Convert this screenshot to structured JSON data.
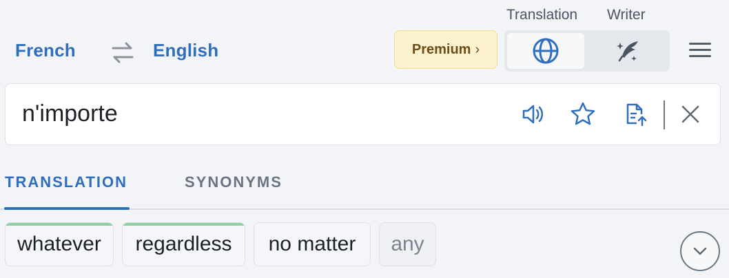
{
  "languages": {
    "source": "French",
    "target": "English",
    "swap_icon": "swap-arrows-icon"
  },
  "premium": {
    "label": "Premium",
    "chevron": "›"
  },
  "modes": {
    "translation_label": "Translation",
    "writer_label": "Writer",
    "active": "Translation",
    "translation_icon": "globe-icon",
    "writer_icon": "quill-sparkle-icon"
  },
  "menu": {
    "icon": "hamburger-menu-icon"
  },
  "input": {
    "value": "n'importe",
    "actions": [
      "speaker-icon",
      "star-icon",
      "export-document-icon",
      "close-icon"
    ]
  },
  "tabs": [
    {
      "label": "TRANSLATION",
      "active": true
    },
    {
      "label": "SYNONYMS",
      "active": false
    }
  ],
  "results": [
    {
      "text": "whatever",
      "highlighted": true
    },
    {
      "text": "regardless",
      "highlighted": true
    },
    {
      "text": "no matter",
      "highlighted": false
    },
    {
      "text": "any",
      "highlighted": false,
      "muted": true
    }
  ],
  "colors": {
    "accent": "#2f6ebd",
    "premium_bg": "#fdf2cf",
    "chip_highlight": "#8fd19e",
    "page_bg": "#f2f4f7"
  }
}
